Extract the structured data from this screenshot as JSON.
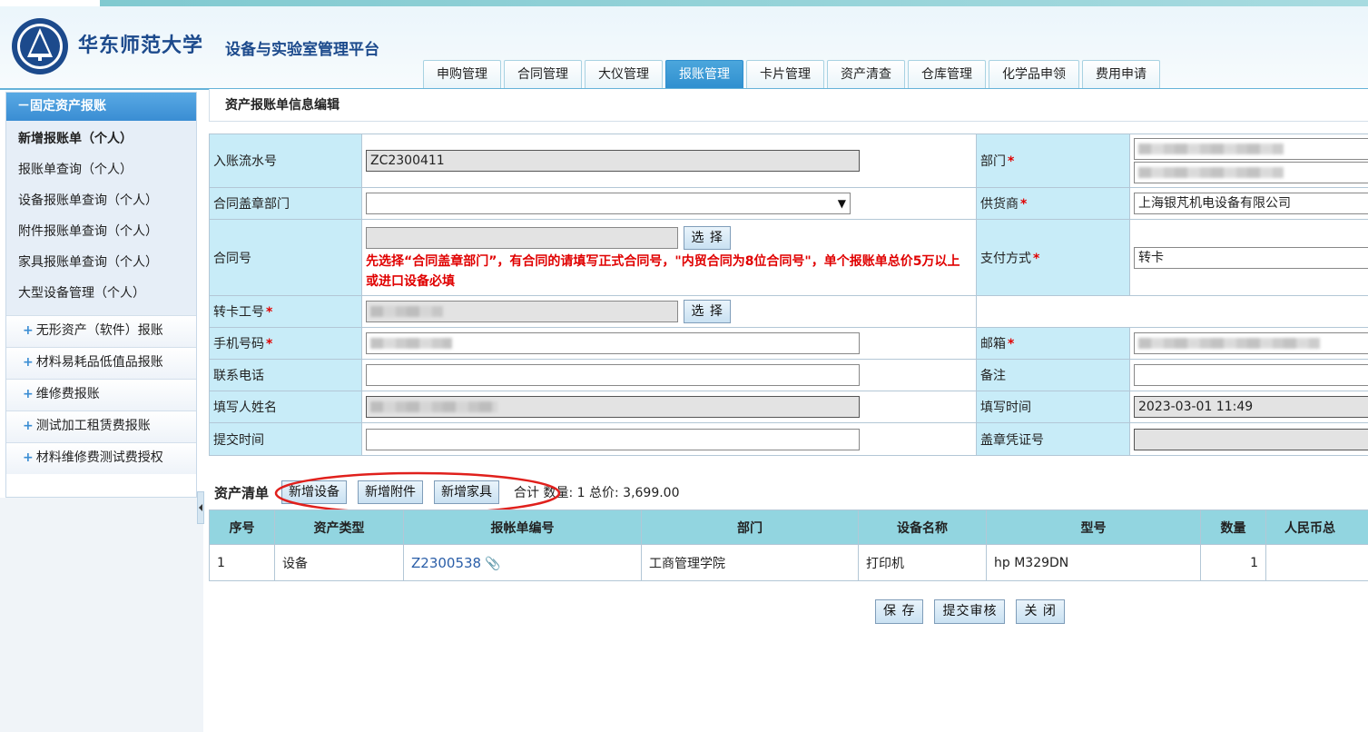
{
  "header": {
    "university_name": "华东师范大学",
    "platform_name": "设备与实验室管理平台",
    "tabs": [
      {
        "label": "申购管理",
        "active": false
      },
      {
        "label": "合同管理",
        "active": false
      },
      {
        "label": "大仪管理",
        "active": false
      },
      {
        "label": "报账管理",
        "active": true
      },
      {
        "label": "卡片管理",
        "active": false
      },
      {
        "label": "资产清查",
        "active": false
      },
      {
        "label": "仓库管理",
        "active": false
      },
      {
        "label": "化学品申领",
        "active": false
      },
      {
        "label": "费用申请",
        "active": false
      }
    ]
  },
  "sidebar": {
    "expanded_section": "－固定资产报账",
    "items": [
      {
        "label": "新增报账单（个人）",
        "current": true
      },
      {
        "label": "报账单查询（个人）",
        "current": false
      },
      {
        "label": "设备报账单查询（个人）",
        "current": false
      },
      {
        "label": "附件报账单查询（个人）",
        "current": false
      },
      {
        "label": "家具报账单查询（个人）",
        "current": false
      },
      {
        "label": "大型设备管理（个人）",
        "current": false
      }
    ],
    "collapsed_sections": [
      {
        "label": "无形资产（软件）报账"
      },
      {
        "label": "材料易耗品低值品报账"
      },
      {
        "label": "维修费报账"
      },
      {
        "label": "测试加工租赁费报账"
      },
      {
        "label": "材料维修费测试费授权"
      }
    ],
    "plus": "+"
  },
  "page_title": "资产报账单信息编辑",
  "form": {
    "entry_serial": {
      "label": "入账流水号",
      "value": "ZC2300411"
    },
    "department": {
      "label": "部门",
      "required_mark": "*"
    },
    "contract_seal_dept": {
      "label": "合同盖章部门",
      "value": ""
    },
    "supplier": {
      "label": "供货商",
      "required_mark": "*",
      "value": "上海银芃机电设备有限公司"
    },
    "contract_no": {
      "label": "合同号",
      "value": "",
      "select_label": "选 择",
      "hint": "先选择“合同盖章部门”，有合同的请填写正式合同号，\"内贸合同为8位合同号\"，单个报账单总价5万以上或进口设备必填"
    },
    "payment_method": {
      "label": "支付方式",
      "required_mark": "*",
      "value": "转卡"
    },
    "card_staff_no": {
      "label": "转卡工号",
      "required_mark": "*",
      "select_label": "选 择"
    },
    "mobile": {
      "label": "手机号码",
      "required_mark": "*"
    },
    "email": {
      "label": "邮箱",
      "required_mark": "*"
    },
    "phone": {
      "label": "联系电话",
      "value": ""
    },
    "remark": {
      "label": "备注",
      "value": ""
    },
    "filler_name": {
      "label": "填写人姓名"
    },
    "fill_time": {
      "label": "填写时间",
      "value": "2023-03-01 11:49"
    },
    "submit_time": {
      "label": "提交时间",
      "value": ""
    },
    "seal_voucher": {
      "label": "盖章凭证号",
      "value": ""
    }
  },
  "asset_list": {
    "title": "资产清单",
    "buttons": {
      "add_device": "新增设备",
      "add_accessory": "新增附件",
      "add_furniture": "新增家具"
    },
    "summary": "合计 数量: 1   总价: 3,699.00",
    "columns": [
      "序号",
      "资产类型",
      "报帐单编号",
      "部门",
      "设备名称",
      "型号",
      "数量",
      "人民币总"
    ],
    "rows": [
      {
        "no": "1",
        "type": "设备",
        "bill_no": "Z2300538",
        "dept": "工商管理学院",
        "device": "打印机",
        "model": "hp M329DN",
        "qty": "1",
        "total": ""
      }
    ],
    "annotation_color": "#e0201c"
  },
  "actions": {
    "save": "保 存",
    "submit": "提交审核",
    "close": "关 闭"
  }
}
